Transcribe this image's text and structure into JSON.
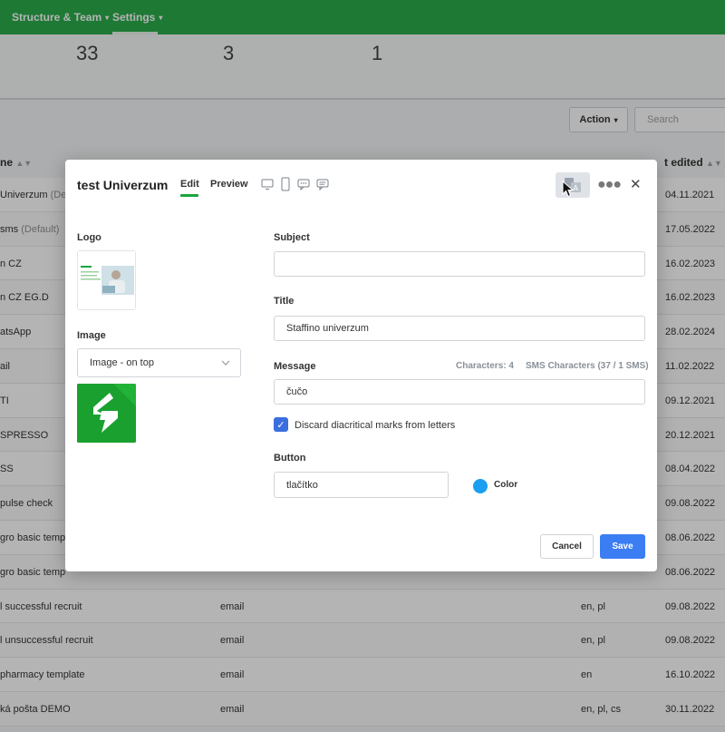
{
  "nav": {
    "items": [
      {
        "label": "Structure & Team",
        "caret": "▾"
      },
      {
        "label": "Settings",
        "caret": "▾"
      }
    ]
  },
  "stats": [
    "33",
    "3",
    "1"
  ],
  "toolbar": {
    "action_label": "Action",
    "search_placeholder": "Search"
  },
  "table": {
    "headers": {
      "name": "ne",
      "edited": "t edited"
    },
    "rows": [
      {
        "name": "Univerzum",
        "name_muted": " (De",
        "type": "",
        "lang": "",
        "date": "04.11.2021"
      },
      {
        "name": "sms",
        "name_muted": " (Default)",
        "type": "",
        "lang": "",
        "date": "17.05.2022"
      },
      {
        "name": "n CZ",
        "name_muted": "",
        "type": "",
        "lang": "",
        "date": "16.02.2023"
      },
      {
        "name": "n CZ EG.D",
        "name_muted": "",
        "type": "",
        "lang": "",
        "date": "16.02.2023"
      },
      {
        "name": "atsApp",
        "name_muted": "",
        "type": "",
        "lang": "",
        "date": "28.02.2024"
      },
      {
        "name": "ail",
        "name_muted": "",
        "type": "",
        "lang": "",
        "date": "11.02.2022"
      },
      {
        "name": "TI",
        "name_muted": "",
        "type": "",
        "lang": "",
        "date": "09.12.2021"
      },
      {
        "name": "SPRESSO",
        "name_muted": "",
        "type": "",
        "lang": "",
        "date": "20.12.2021"
      },
      {
        "name": "SS",
        "name_muted": "",
        "type": "",
        "lang": "",
        "date": "08.04.2022"
      },
      {
        "name": "pulse check",
        "name_muted": "",
        "type": "",
        "lang": "",
        "date": "09.08.2022"
      },
      {
        "name": "gro basic templ",
        "name_muted": "",
        "type": "",
        "lang": "",
        "date": "08.06.2022"
      },
      {
        "name": "gro basic temp",
        "name_muted": "",
        "type": "",
        "lang": "",
        "date": "08.06.2022"
      },
      {
        "name": "l successful recruit",
        "name_muted": "",
        "type": "email",
        "lang": "en, pl",
        "date": "09.08.2022"
      },
      {
        "name": "l unsuccessful recruit",
        "name_muted": "",
        "type": "email",
        "lang": "en, pl",
        "date": "09.08.2022"
      },
      {
        "name": "pharmacy template",
        "name_muted": "",
        "type": "email",
        "lang": "en",
        "date": "16.10.2022"
      },
      {
        "name": "ká pošta DEMO",
        "name_muted": "",
        "type": "email",
        "lang": "en, pl, cs",
        "date": "30.11.2022"
      }
    ]
  },
  "modal": {
    "title": "test Univerzum",
    "tabs": {
      "edit": "Edit",
      "preview": "Preview"
    },
    "logo_label": "Logo",
    "image_label": "Image",
    "image_select_value": "Image - on top",
    "subject_label": "Subject",
    "subject_value": "",
    "title_label": "Title",
    "title_value": "Staffino univerzum",
    "message_label": "Message",
    "characters_count": "Characters: 4",
    "sms_characters": "SMS Characters (37 / 1 SMS)",
    "message_value": "čučo",
    "discard_label": "Discard diacritical marks from letters",
    "discard_checked": true,
    "button_label": "Button",
    "button_value": "tlačítko",
    "color_label": "Color",
    "color_value": "#1a9ff0",
    "cancel_label": "Cancel",
    "save_label": "Save"
  },
  "colors": {
    "brand_green": "#19a53b",
    "primary_blue": "#3b7df2"
  }
}
